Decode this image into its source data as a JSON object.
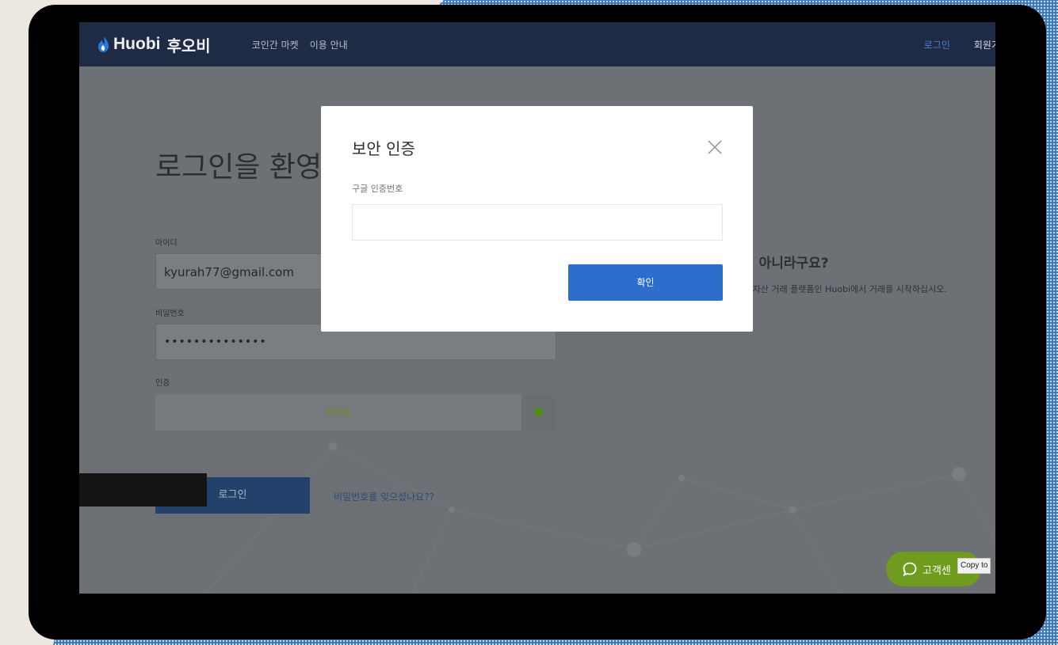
{
  "navbar": {
    "brand": "Huobi",
    "brand_kr": "후오비",
    "links": [
      "코인간 마켓",
      "이용 안내"
    ],
    "login": "로그인",
    "signup": "회원가"
  },
  "login_form": {
    "welcome": "로그인을 환영합",
    "id_label": "아이디",
    "id_value": "kyurah77@gmail.com",
    "password_label": "비밀번호",
    "password_value": "••••••••••••••",
    "verify_label": "인증",
    "verify_status": "확인됨",
    "login_button": "로그인",
    "forgot_link": "비밀번호를 잊으셨나요??"
  },
  "signup_promo": {
    "title": "이 아니라구요?",
    "subtitle": "털 자산 거래 플랫폼인 Huobi에서 거래를 시작하십시오."
  },
  "modal": {
    "title": "보안 인증",
    "code_label": "구글 인증번호",
    "code_value": "",
    "confirm_button": "확인"
  },
  "customer_service": {
    "label": "고객센",
    "tooltip": "Copy to"
  },
  "colors": {
    "navbar_bg": "#1f2a44",
    "accent_blue": "#2d6ecd",
    "verified_green": "#6f9b1e"
  },
  "icons": [
    "huobi-flame-icon",
    "close-icon",
    "verified-dot-icon",
    "chat-bubble-icon"
  ]
}
